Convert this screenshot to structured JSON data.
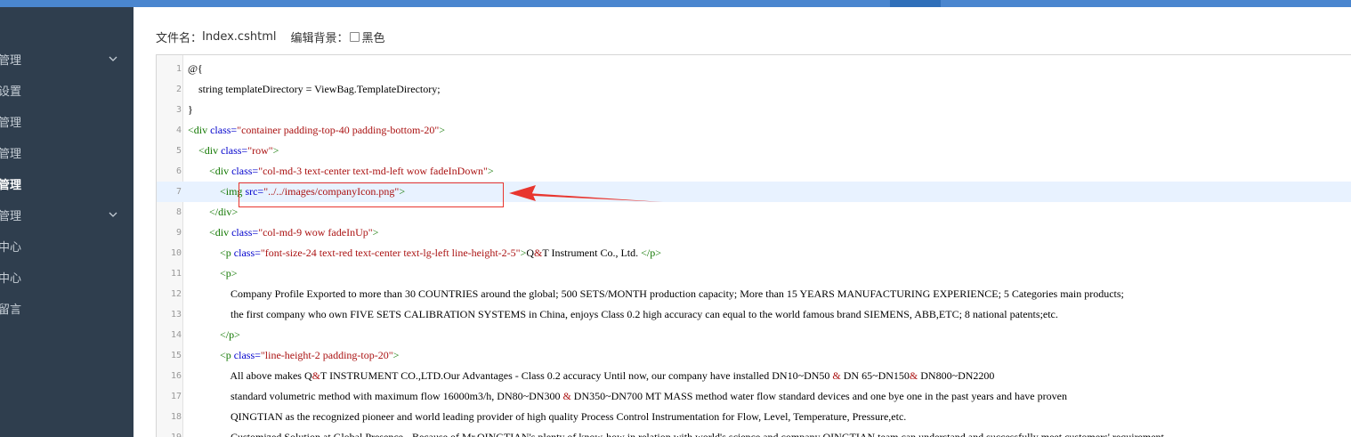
{
  "sidebar": {
    "items": [
      {
        "label": "管理",
        "chevron": true
      },
      {
        "label": "设置",
        "chevron": false
      },
      {
        "label": "管理",
        "chevron": false
      },
      {
        "label": "管理",
        "chevron": false
      },
      {
        "label": "管理",
        "chevron": false,
        "active": true
      },
      {
        "label": "管理",
        "chevron": true
      },
      {
        "label": "中心",
        "chevron": false
      },
      {
        "label": "中心",
        "chevron": false
      },
      {
        "label": "留言",
        "chevron": false
      }
    ]
  },
  "fileinfo": {
    "filename_label": "文件名：",
    "filename": "Index.cshtml",
    "bg_label": "编辑背景：",
    "dark_label": "黑色"
  },
  "colors": {
    "sidebar_bg": "#2f3e4e",
    "topbar": "#4a86cf",
    "annotation_red": "#e8362f",
    "highlight_line": "#e8f2ff"
  },
  "editor": {
    "highlighted_line": 7,
    "lines": [
      "@{",
      "    string templateDirectory = ViewBag.TemplateDirectory;",
      "}",
      "<div class=\"container padding-top-40 padding-bottom-20\">",
      "    <div class=\"row\">",
      "        <div class=\"col-md-3 text-center text-md-left wow fadeInDown\">",
      "            <img src=\"../../images/companyIcon.png\">",
      "        </div>",
      "        <div class=\"col-md-9 wow fadeInUp\">",
      "            <p class=\"font-size-24 text-red text-center text-lg-left line-height-2-5\">Q&T Instrument Co., Ltd. </p>",
      "            <p>",
      "                Company Profile Exported to more than 30 COUNTRIES around the global; 500 SETS/MONTH production capacity; More than 15 YEARS MANUFACTURING EXPERIENCE; 5 Categories main products;",
      "                the first company who own FIVE SETS CALIBRATION SYSTEMS in China, enjoys Class 0.2 high accuracy can equal to the world famous brand SIEMENS, ABB,ETC; 8 national patents;etc.",
      "            </p>",
      "            <p class=\"line-height-2 padding-top-20\">",
      "                All above makes Q&T INSTRUMENT CO.,LTD.Our Advantages - Class 0.2 accuracy Until now, our company have installed DN10~DN50 & DN 65~DN150& DN800~DN2200",
      "                standard volumetric method with maximum flow 16000m3/h, DN80~DN300 & DN350~DN700 MT MASS method water flow standard devices and one bye one in the past years and have proven",
      "                QINGTIAN as the recognized pioneer and world leading provider of high quality Process Control Instrumentation for Flow, Level, Temperature, Pressure,etc.",
      "                Customized Solution at Global Presence - Because of Mr.QINGTIAN's plenty of know-how in relation with world's science and company QINGTIAN team can understand and successfully meet customers' requirement"
    ]
  }
}
